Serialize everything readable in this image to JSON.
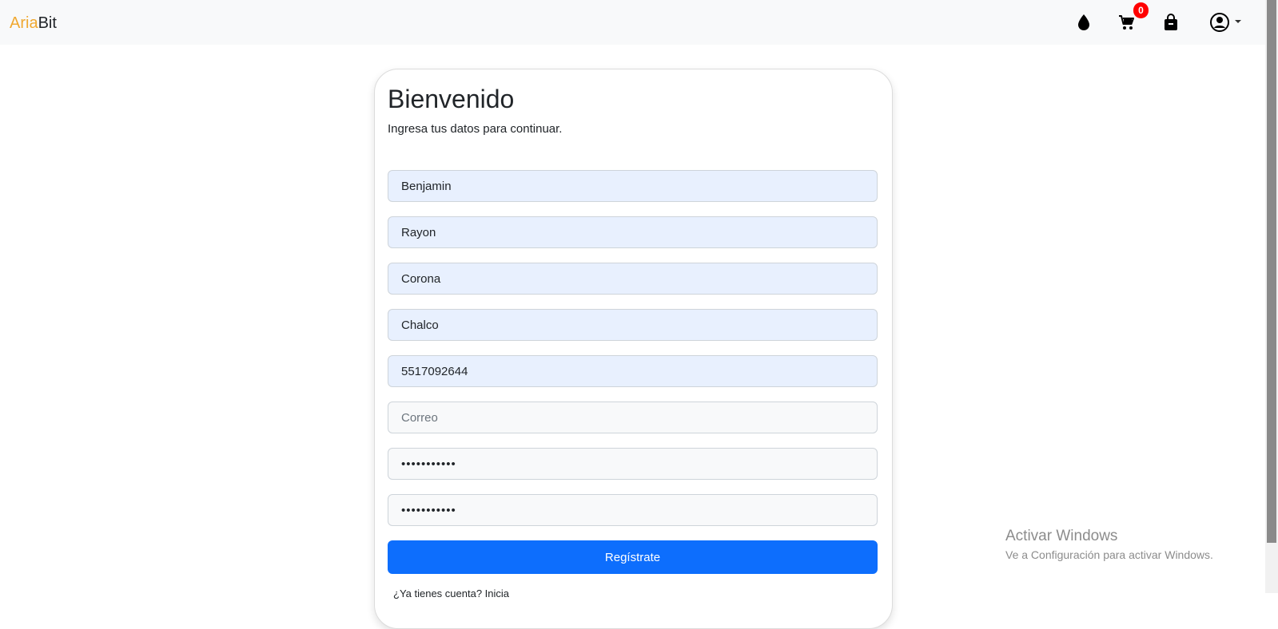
{
  "brand": {
    "part1": "Aria",
    "part2": "Bit"
  },
  "nav": {
    "cart_count": "0",
    "icons": [
      "drop-icon",
      "cart-icon",
      "bag-icon",
      "user-icon"
    ]
  },
  "form": {
    "title": "Bienvenido",
    "subtitle": "Ingresa tus datos para continuar.",
    "fields": [
      {
        "value": "Benjamin",
        "placeholder": ""
      },
      {
        "value": "Rayon",
        "placeholder": ""
      },
      {
        "value": "Corona",
        "placeholder": ""
      },
      {
        "value": "Chalco",
        "placeholder": ""
      },
      {
        "value": "5517092644",
        "placeholder": ""
      },
      {
        "value": "",
        "placeholder": "Correo"
      },
      {
        "value": "•••••••••••",
        "placeholder": ""
      },
      {
        "value": "•••••••••••",
        "placeholder": ""
      }
    ],
    "submit_label": "Regístrate",
    "footer_partial": "¿Ya tienes cuenta? Inicia"
  },
  "watermark": {
    "title": "Activar Windows",
    "subtitle": "Ve a Configuración para activar Windows."
  },
  "colors": {
    "brand_accent": "#f0a830",
    "primary": "#0d6efd",
    "badge": "#ff0000",
    "autofill": "#e8f0fe"
  }
}
